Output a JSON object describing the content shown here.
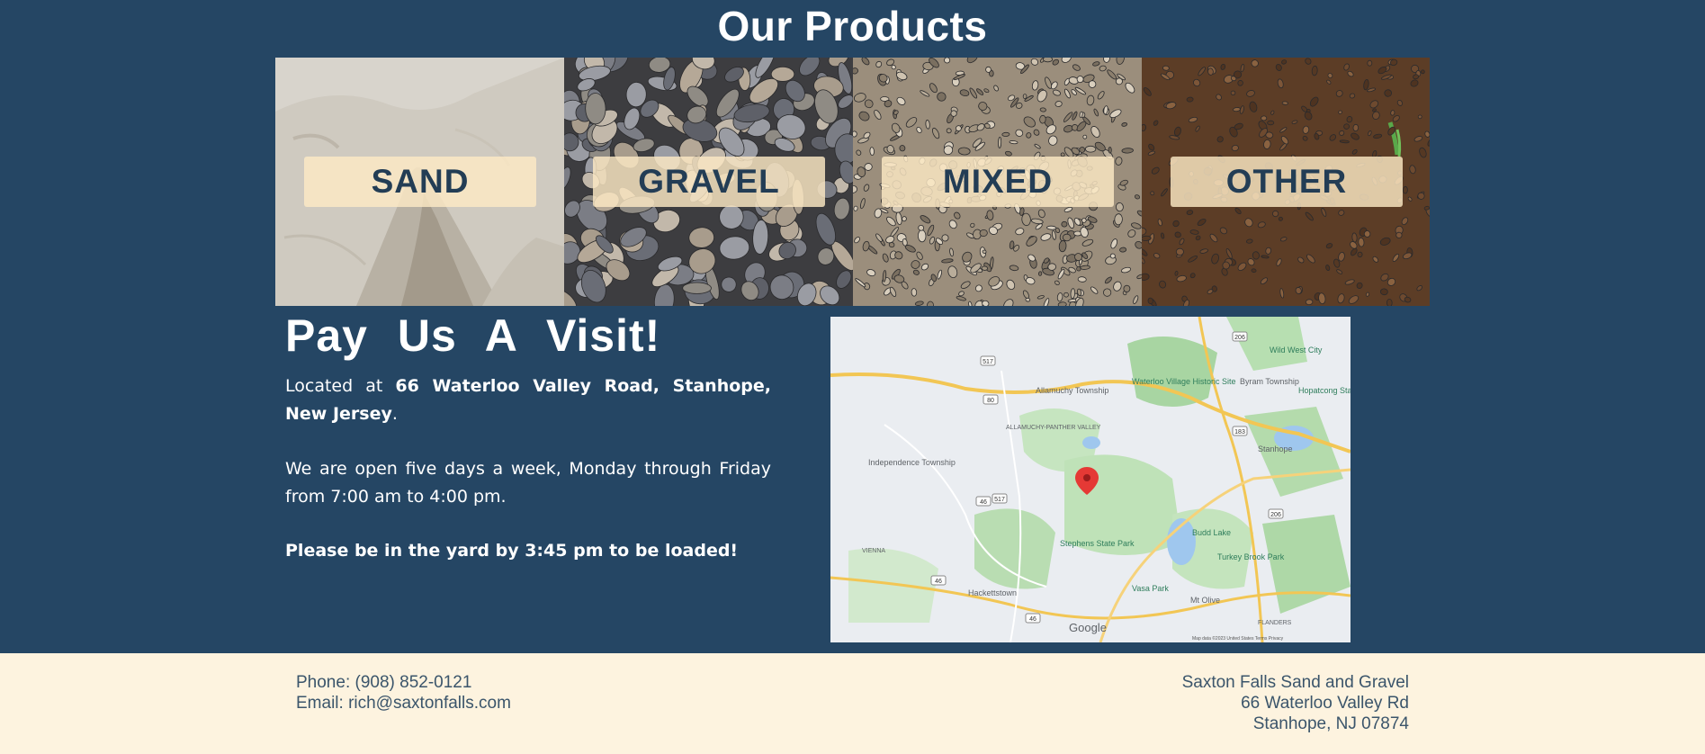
{
  "products": {
    "title": "Our Products",
    "items": [
      {
        "label": "SAND"
      },
      {
        "label": "GRAVEL"
      },
      {
        "label": "MIXED"
      },
      {
        "label": "OTHER"
      }
    ]
  },
  "visit": {
    "title": "Pay Us A Visit!",
    "located_prefix": "Located at ",
    "address_bold": "66 Waterloo Valley Road, Stanhope, New Jersey",
    "located_suffix": ".",
    "hours": "We are open five days a week, Monday through Friday from 7:00 am to 4:00 pm.",
    "notice": "Please be in the yard by 3:45 pm to be loaded!"
  },
  "map": {
    "places": [
      "Wild West City",
      "Byram Township",
      "Hopatcong State",
      "Allamuchy Township",
      "Waterloo Village Historic Site",
      "ALLAMUCHY-PANTHER VALLEY",
      "Stanhope",
      "Independence Township",
      "Stephens State Park",
      "Budd Lake",
      "Turkey Brook Park",
      "VIENNA",
      "Hackettstown",
      "Vasa Park",
      "Mt Olive",
      "FLANDERS"
    ],
    "routes": [
      "517",
      "80",
      "206",
      "183",
      "46",
      "517",
      "206",
      "46",
      "46"
    ],
    "logo": "Google",
    "attribution": "Map data ©2023   United States   Terms   Privacy"
  },
  "footer": {
    "phone": "Phone: (908) 852-0121",
    "email": "Email: rich@saxtonfalls.com",
    "company": "Saxton Falls Sand and Gravel",
    "street": "66 Waterloo Valley Rd",
    "city": "Stanhope, NJ 07874"
  }
}
